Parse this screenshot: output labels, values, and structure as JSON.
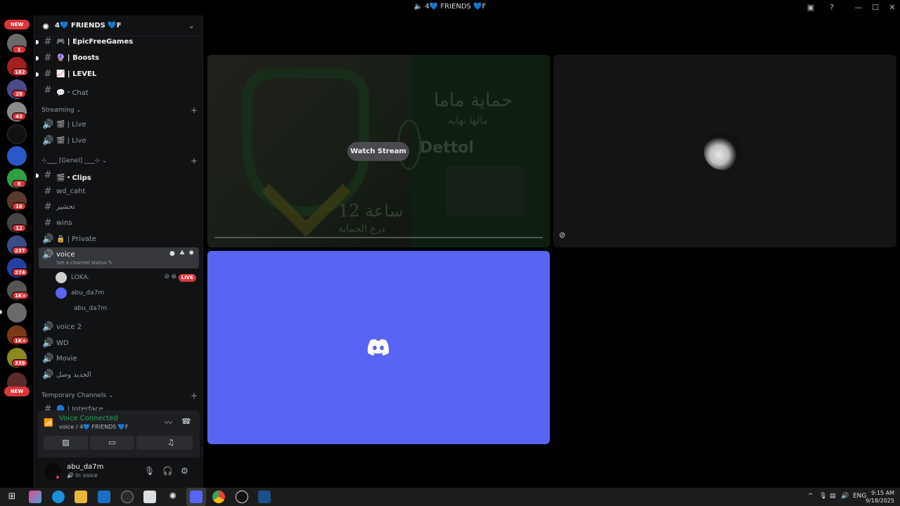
{
  "window": {
    "title": "4💙 FRIENDS 💙F"
  },
  "server_rail": {
    "new_badge_top": "NEW",
    "new_badge_bottom": "NEW",
    "badges": [
      "1",
      "182",
      "29",
      "43",
      "8",
      "16",
      "12",
      "237",
      "274",
      "1K+",
      "1K+",
      "339"
    ]
  },
  "guild": {
    "name": "4💙 FRIENDS 💙F"
  },
  "channels": [
    {
      "icon": "#",
      "label": "🎮 | EpicFreeGames",
      "bold": true
    },
    {
      "icon": "#",
      "label": "🔮 | Boosts",
      "bold": true
    },
    {
      "icon": "#",
      "label": "📈 | LEVEL",
      "bold": true
    },
    {
      "icon": "#",
      "label": "💬・Chat",
      "bold": false
    },
    {
      "icon": "🔊",
      "label": "🎬 | Live",
      "bold": false
    },
    {
      "icon": "🔊",
      "label": "🎬 | Live",
      "bold": false
    },
    {
      "icon": "#",
      "label": "🎬・Clips",
      "bold": true
    },
    {
      "icon": "#",
      "label": "wd_caht",
      "bold": false
    },
    {
      "icon": "#",
      "label": "تحشير",
      "bold": false
    },
    {
      "icon": "#",
      "label": "wins",
      "bold": false
    },
    {
      "icon": "🔊",
      "label": "🔒 | Private",
      "bold": false
    },
    {
      "icon": "🔊",
      "label": "voice",
      "bold": false
    },
    {
      "icon": "🔊",
      "label": "voice 2",
      "bold": false
    },
    {
      "icon": "🔊",
      "label": "WD",
      "bold": false
    },
    {
      "icon": "🔊",
      "label": "Movie",
      "bold": false
    },
    {
      "icon": "🔊",
      "label": "الجديد وصل",
      "bold": false
    },
    {
      "icon": "#",
      "label": "🔵 | Interface",
      "bold": false
    }
  ],
  "categories": {
    "streaming": "Streaming",
    "genel": "⊹‿‿ [Genel] ‿‿⊹",
    "temporary": "Temporary Channels"
  },
  "voice_channel": {
    "status_hint": "Set a channel status"
  },
  "voice_users": [
    {
      "name": "LOKA.",
      "live": "LIVE"
    },
    {
      "name": "abu_da7m"
    },
    {
      "name": "abu_da7m"
    }
  ],
  "voice_connected": {
    "title": "Voice Connected",
    "subtitle": "voice / 4💙 FRIENDS 💙F"
  },
  "user": {
    "name": "abu_da7m",
    "status": "In voice"
  },
  "stage": {
    "watch_label": "Watch Stream",
    "stream_text_1": "حماية ماما",
    "stream_text_2": "مالها نهاية",
    "stream_text_3": "12 ساعة",
    "stream_text_4": "درع الحماية",
    "stream_brand": "Dettol"
  },
  "taskbar": {
    "lang": "ENG",
    "time": "9:15 AM",
    "date": "9/18/2025"
  },
  "colors": {
    "blurple": "#5865f2",
    "green": "#23a55a",
    "red": "#da373c"
  }
}
